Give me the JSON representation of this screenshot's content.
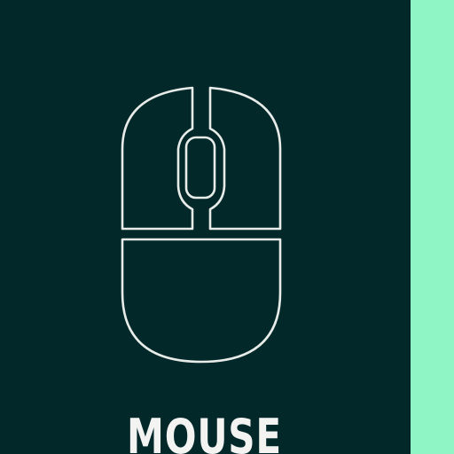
{
  "colors": {
    "background": "#03282a",
    "accent": "#8ff5c4",
    "icon_stroke": "#e8ece9",
    "label_text": "#f3f4f2"
  },
  "card": {
    "icon": "mouse-icon",
    "label": "MOUSE"
  }
}
